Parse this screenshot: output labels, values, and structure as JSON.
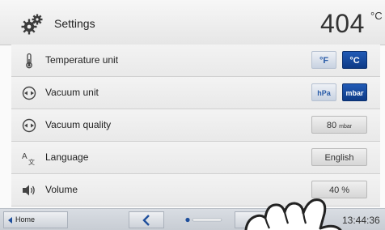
{
  "header": {
    "title": "Settings",
    "icon": "gear-icon",
    "temperature": "404",
    "temperature_unit": "°C"
  },
  "rows": [
    {
      "icon": "thermometer-icon",
      "label": "Temperature unit",
      "options": [
        "°F",
        "°C"
      ],
      "selected": "°C"
    },
    {
      "icon": "vacuum-gauge-icon",
      "label": "Vacuum unit",
      "options": [
        "hPa",
        "mbar"
      ],
      "selected": "mbar"
    },
    {
      "icon": "vacuum-gauge-icon",
      "label": "Vacuum quality",
      "value": "80",
      "value_unit": "mbar"
    },
    {
      "icon": "language-icon",
      "label": "Language",
      "value": "English"
    },
    {
      "icon": "speaker-icon",
      "label": "Volume",
      "value": "40 %"
    }
  ],
  "footer": {
    "home_label": "Home",
    "time": "13:44:36"
  },
  "colors": {
    "accent": "#164a9e",
    "accent_light": "#c8d2e1"
  }
}
